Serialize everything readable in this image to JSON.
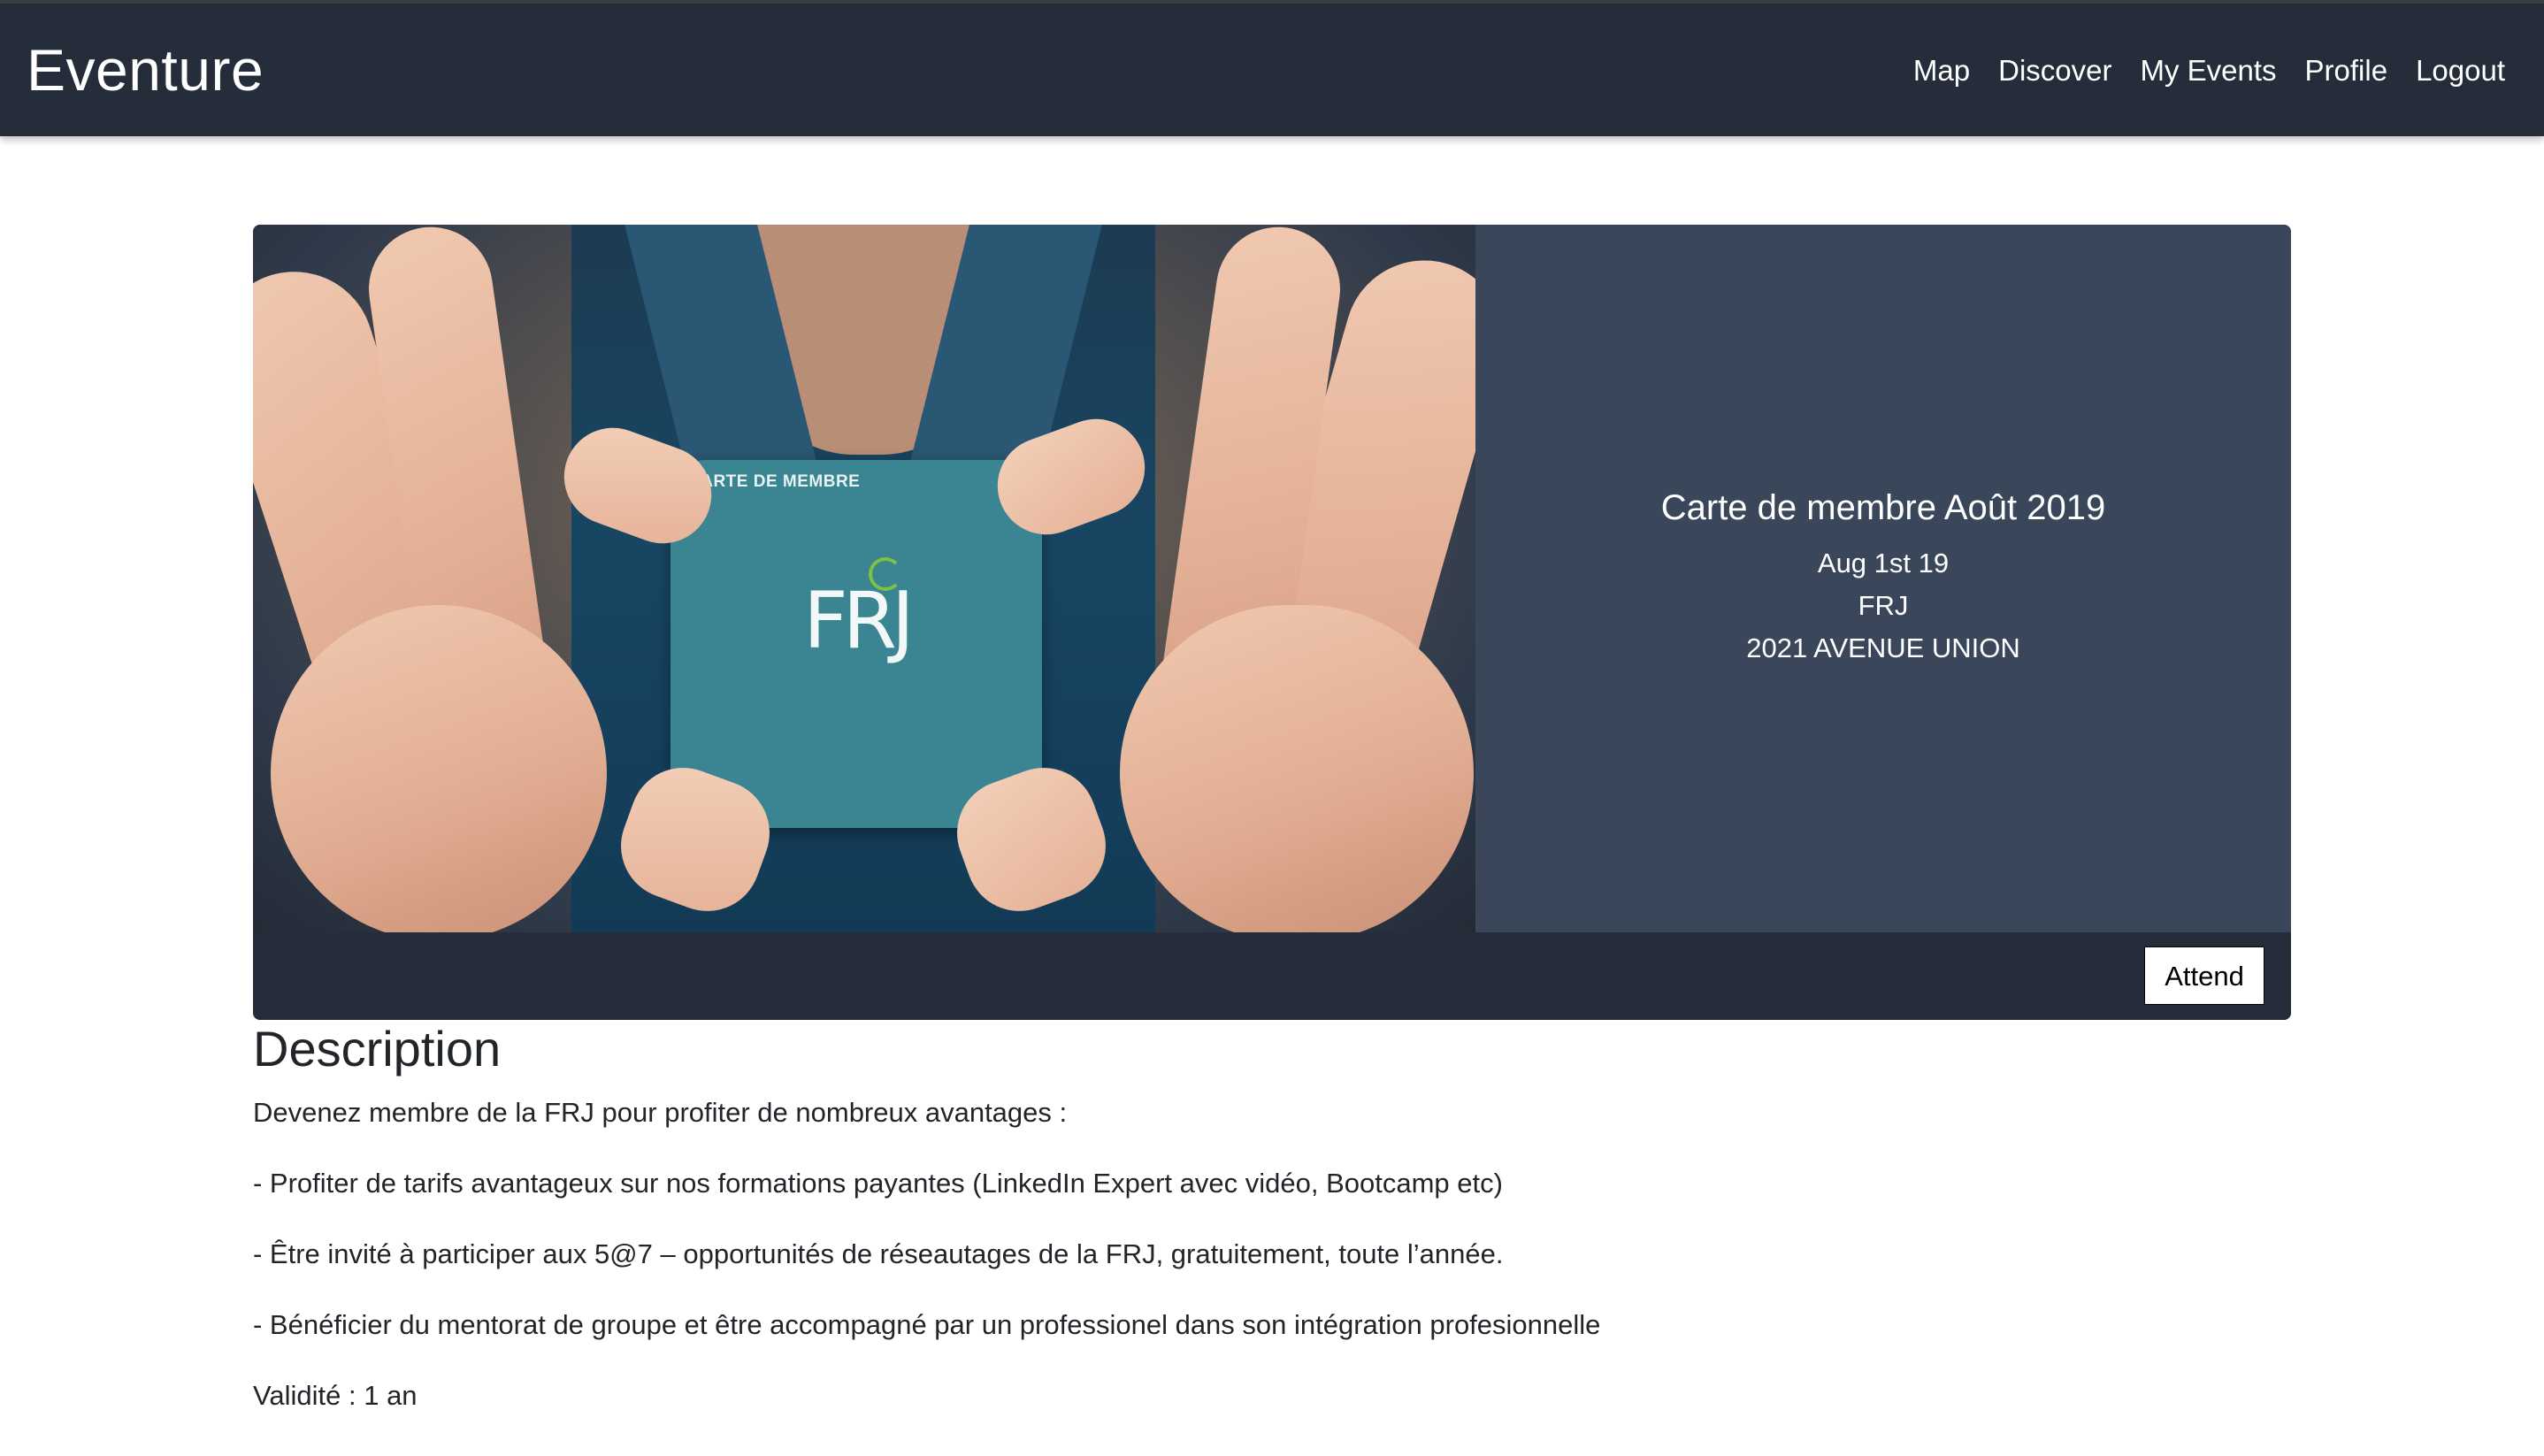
{
  "navbar": {
    "brand": "Eventure",
    "links": [
      "Map",
      "Discover",
      "My Events",
      "Profile",
      "Logout"
    ],
    "background": "#252d3b"
  },
  "event": {
    "image_card_title": "CARTE DE MEMBRE",
    "image_card_logo": "FRJ",
    "title": "Carte de membre Août 2019",
    "date": "Aug 1st 19",
    "organizer": "FRJ",
    "address": "2021 AVENUE UNION",
    "attend_label": "Attend",
    "info_background": "#3a4659"
  },
  "description": {
    "heading": "Description",
    "paragraphs": [
      "Devenez membre de la FRJ pour profiter de nombreux avantages :",
      "- Profiter de tarifs avantageux sur nos formations payantes (LinkedIn Expert avec vidéo, Bootcamp etc)",
      "- Être invité à participer aux 5@7 – opportunités de réseautages de la FRJ, gratuitement, toute l’année.",
      "- Bénéficier du mentorat de groupe et être accompagné par un professionel dans son intégration profesionnelle",
      "Validité : 1 an"
    ]
  }
}
